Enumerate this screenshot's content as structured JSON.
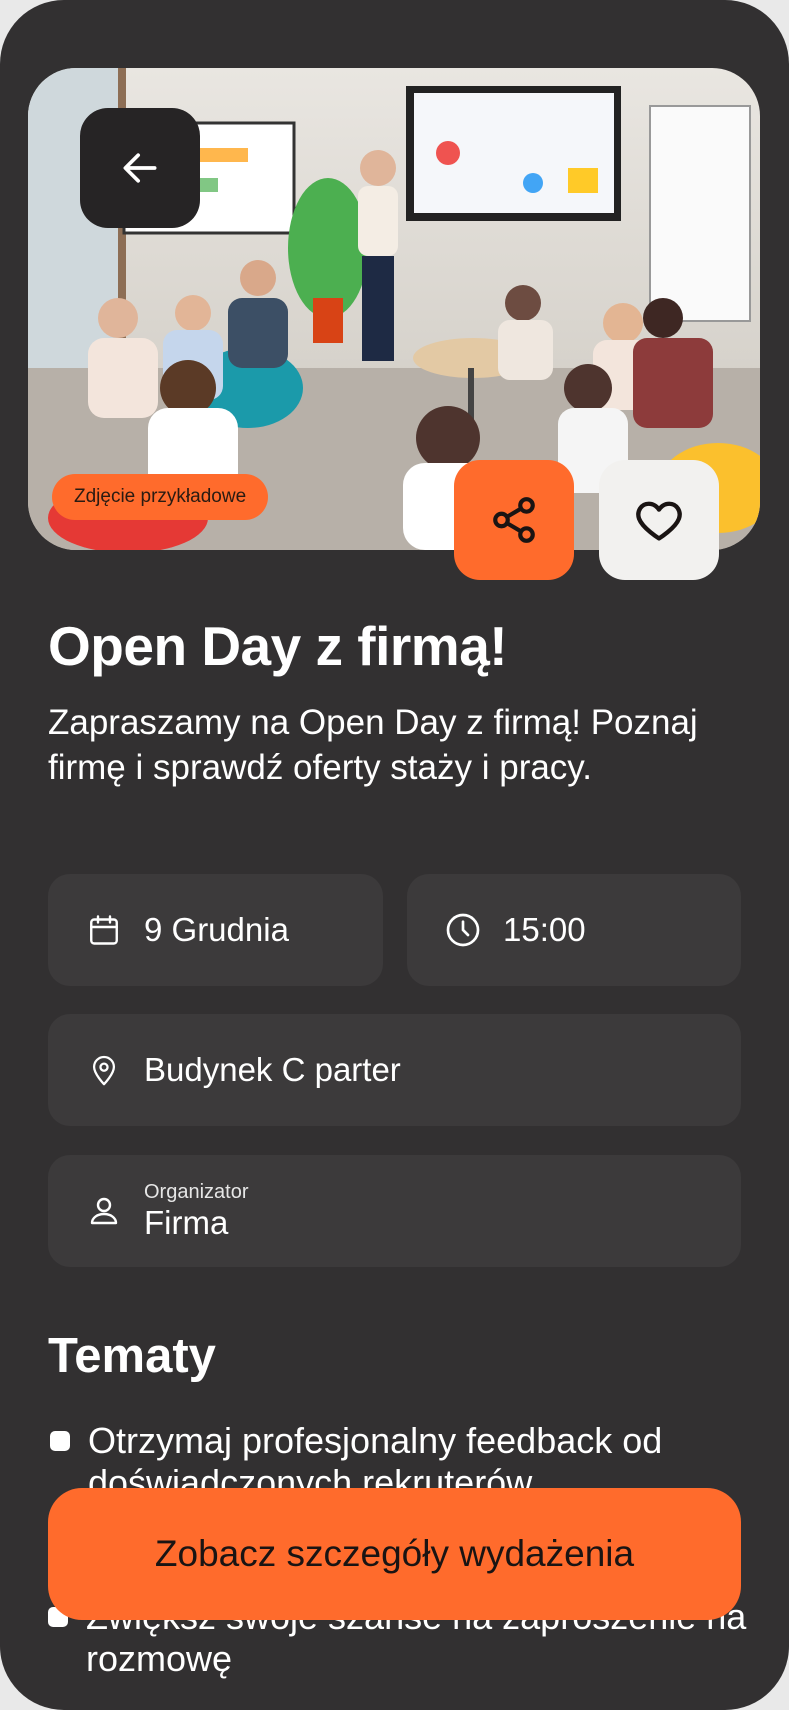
{
  "hero": {
    "badge": "Zdjęcie przykładowe"
  },
  "event": {
    "title": "Open Day z firmą!",
    "description": "Zapraszamy na Open Day z firmą! Poznaj firmę i sprawdź oferty staży i pracy.",
    "date": "9 Grudnia",
    "time": "15:00",
    "location": "Budynek C parter",
    "organizer_label": "Organizator",
    "organizer": "Firma"
  },
  "topics": {
    "heading": "Tematy",
    "items": [
      "Otrzymaj profesjonalny feedback od doświadczonych rekruterów",
      "Zwiększ swoje szanse na zaproszenie na rozmowę"
    ]
  },
  "cta": {
    "label": "Zobacz szczegóły wydażenia"
  },
  "colors": {
    "background": "#323031",
    "card": "#3c3a3b",
    "accent": "#ff6b2c",
    "favorite_button": "#f2f1ef"
  },
  "icons": [
    "arrow-left-icon",
    "share-icon",
    "heart-icon",
    "calendar-icon",
    "clock-icon",
    "map-pin-icon",
    "user-icon"
  ]
}
